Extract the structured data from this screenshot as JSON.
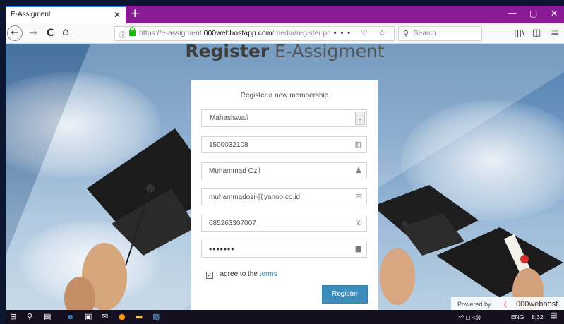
{
  "browser": {
    "tab_title": "E-Assigment",
    "tab_close": "✕",
    "new_tab": "+",
    "window_controls": {
      "minimize": "—",
      "maximize": "▢",
      "close": "✕"
    },
    "nav": {
      "back": "←",
      "forward": "→",
      "reload": "C",
      "home": "⌂"
    },
    "url": {
      "info_icon": "ⓘ",
      "prefix": "https://e-assigment.",
      "host": "000webhostapp.com",
      "path": "/media/register.ph",
      "actions": "••• ♡ ☆"
    },
    "search_placeholder": "Search",
    "toolbar_icons": {
      "library": "|||\\",
      "sidebar": "◫",
      "menu": "≡"
    }
  },
  "page": {
    "heading_bold": "Register",
    "heading_rest": "E-Assigment",
    "form": {
      "title": "Register a new membership",
      "role_select": "Mahasiswa/i",
      "select_arrow": "⌄",
      "nim": "1500032108",
      "name": "Muhammad Ozil",
      "email": "muhammadozil@yahoo.co.id",
      "phone": "085263307007",
      "password": "•••••••",
      "icons": {
        "nim": "barcode-icon",
        "name": "user-icon",
        "email": "envelope-icon",
        "phone": "phone-icon",
        "password": "lock-icon"
      },
      "icon_glyphs": {
        "nim": "▥",
        "name": "♟",
        "email": "✉",
        "phone": "✆",
        "password": "■"
      },
      "agree_checkmark": "✓",
      "agree_text": "I agree to the",
      "terms_link": "terms",
      "submit": "Register"
    },
    "powered_by": {
      "label": "Powered by",
      "brand": "000webhost",
      "logo": "⦅"
    }
  },
  "taskbar": {
    "clock": "8:32",
    "language": "ENG",
    "tray_icons": ">^ ◻ ◁))",
    "notification_glyph": "▤"
  },
  "colors": {
    "tab_bar": "#8b1a96",
    "accent_button": "#3c8dbc",
    "terms_link": "#3c8dbc",
    "taskbar": "#15101f"
  }
}
